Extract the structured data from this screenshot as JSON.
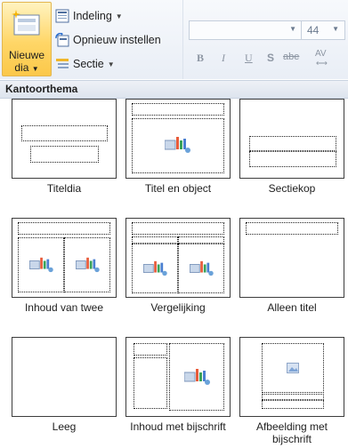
{
  "ribbon": {
    "new_slide": {
      "line1": "Nieuwe",
      "line2": "dia",
      "icon": "new-slide-icon"
    },
    "layout_button": {
      "label": "Indeling",
      "icon": "layout-icon"
    },
    "reset_button": {
      "label": "Opnieuw instellen",
      "icon": "reset-icon"
    },
    "section_button": {
      "label": "Sectie",
      "icon": "section-icon"
    },
    "font_name": {
      "value": "",
      "placeholder": ""
    },
    "font_size": {
      "value": "44"
    },
    "format_buttons": {
      "bold": "B",
      "italic": "I",
      "underline": "U",
      "shadow": "S",
      "strike": "abe",
      "spacing": "AV"
    }
  },
  "gallery": {
    "header": "Kantoorthema",
    "layouts": [
      {
        "name": "Titeldia"
      },
      {
        "name": "Titel en object"
      },
      {
        "name": "Sectiekop"
      },
      {
        "name": "Inhoud van twee"
      },
      {
        "name": "Vergelijking"
      },
      {
        "name": "Alleen titel"
      },
      {
        "name": "Leeg"
      },
      {
        "name": "Inhoud met bijschrift"
      },
      {
        "name": "Afbeelding met bijschrift"
      }
    ]
  },
  "colors": {
    "accent": "#ffd667",
    "ribbon": "#e9eef6",
    "border": "#3d3d3d"
  }
}
